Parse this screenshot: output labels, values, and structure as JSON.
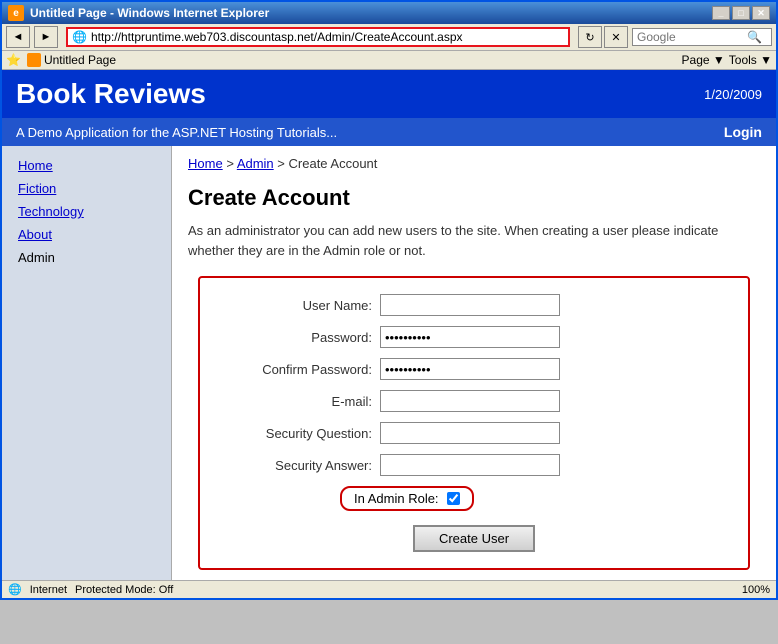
{
  "browser": {
    "title": "Untitled Page - Windows Internet Explorer",
    "address": "http://httpruntime.web703.discountasp.net/Admin/CreateAccount.aspx",
    "tab_label": "Untitled Page",
    "search_placeholder": "Google",
    "nav_back": "◄",
    "nav_forward": "►",
    "nav_refresh": "↻",
    "nav_stop": "✕",
    "nav_go": "→"
  },
  "site": {
    "title": "Book Reviews",
    "date": "1/20/2009",
    "tagline": "A Demo Application for the ASP.NET Hosting Tutorials...",
    "login_label": "Login"
  },
  "nav": {
    "items": [
      {
        "label": "Home",
        "active": false
      },
      {
        "label": "Fiction",
        "active": false
      },
      {
        "label": "Technology",
        "active": false
      },
      {
        "label": "About",
        "active": false
      },
      {
        "label": "Admin",
        "active": true
      }
    ]
  },
  "breadcrumb": {
    "parts": [
      "Home",
      "Admin",
      "Create Account"
    ],
    "separator": ">"
  },
  "page": {
    "title": "Create Account",
    "description": "As an administrator you can add new users to the site. When creating a user please indicate whether they are in the Admin role or not."
  },
  "form": {
    "fields": [
      {
        "label": "User Name:",
        "type": "text",
        "value": ""
      },
      {
        "label": "Password:",
        "type": "password",
        "value": "••••••••••"
      },
      {
        "label": "Confirm Password:",
        "type": "password",
        "value": "••••••••••"
      },
      {
        "label": "E-mail:",
        "type": "text",
        "value": ""
      },
      {
        "label": "Security Question:",
        "type": "text",
        "value": ""
      },
      {
        "label": "Security Answer:",
        "type": "text",
        "value": ""
      }
    ],
    "admin_role_label": "In Admin Role:",
    "admin_role_checked": true,
    "submit_label": "Create User"
  },
  "status_bar": {
    "status": "Internet",
    "protected_mode": "Protected Mode: Off",
    "zoom": "100%"
  }
}
